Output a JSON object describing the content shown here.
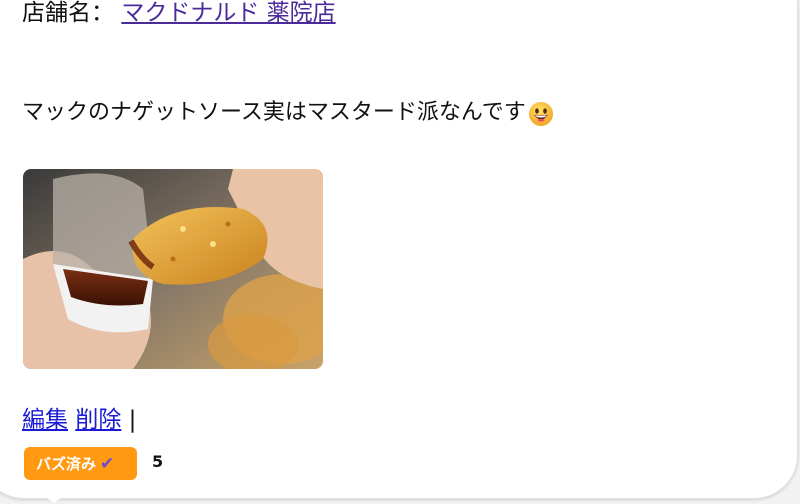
{
  "post": {
    "store_label": "店舗名：",
    "store_name": "マクドナルド 薬院店",
    "text": "マックのナゲットソース実はマスタード派なんです",
    "emoji_icon": "grinning-face-emoji",
    "photo_icon": "chicken-nugget-sauce-photo"
  },
  "actions": {
    "edit_label": "編集",
    "delete_label": "削除",
    "separator": "|"
  },
  "buzz": {
    "badge_label": "バズ済み",
    "check_icon": "check-icon",
    "count": "5"
  },
  "colors": {
    "badge_bg": "#ff9a12",
    "store_link": "#4b2a9a",
    "action_link": "#1a1ad6",
    "check": "#6a4bd8"
  }
}
